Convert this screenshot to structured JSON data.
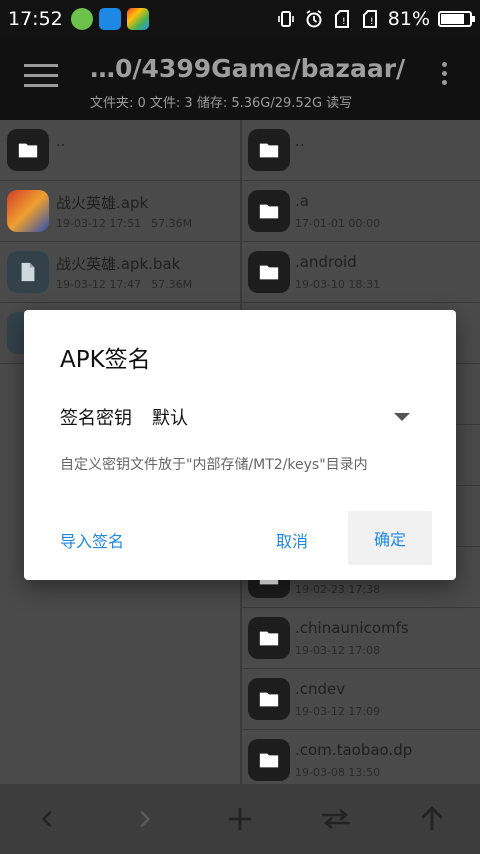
{
  "status": {
    "time": "17:52",
    "battery": "81%"
  },
  "toolbar": {
    "path": "…0/4399Game/bazaar/",
    "info": "文件夹: 0  文件: 3  储存: 5.36G/29.52G  读写"
  },
  "left_pane": {
    "items": [
      {
        "name": "..",
        "meta_date": "",
        "meta_size": ""
      },
      {
        "name": "战火英雄.apk",
        "meta_date": "19-03-12 17:51",
        "meta_size": "57.36M"
      },
      {
        "name": "战火英雄.apk.bak",
        "meta_date": "19-03-12 17:47",
        "meta_size": "57.36M"
      }
    ]
  },
  "right_pane": {
    "items": [
      {
        "name": "..",
        "meta_date": ""
      },
      {
        "name": ".a",
        "meta_date": "17-01-01 00:00"
      },
      {
        "name": ".android",
        "meta_date": "19-03-10 18:31"
      },
      {
        "name": "",
        "meta_date": ""
      },
      {
        "name": "",
        "meta_date": ""
      },
      {
        "name": "",
        "meta_date": ""
      },
      {
        "name": "",
        "meta_date": ""
      },
      {
        "name": "",
        "meta_date": "19-02-23 17:38"
      },
      {
        "name": ".chinaunicomfs",
        "meta_date": "19-03-12 17:08"
      },
      {
        "name": ".cndev",
        "meta_date": "19-03-12 17:09"
      },
      {
        "name": ".com.taobao.dp",
        "meta_date": "19-03-08 13:50"
      }
    ]
  },
  "dialog": {
    "title": "APK签名",
    "key_label": "签名密钥",
    "key_value": "默认",
    "hint": "自定义密钥文件放于\"内部存储/MT2/keys\"目录内",
    "import_label": "导入签名",
    "cancel_label": "取消",
    "ok_label": "确定"
  },
  "colors": {
    "accent": "#1e88e5"
  }
}
